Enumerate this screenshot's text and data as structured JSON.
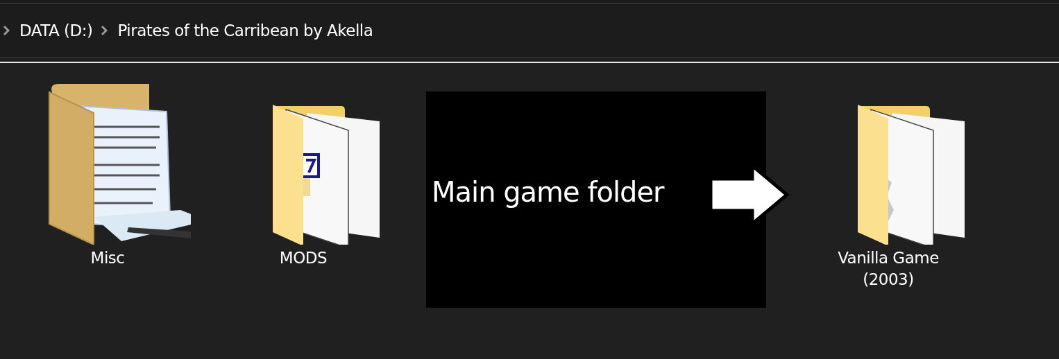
{
  "breadcrumb": [
    {
      "label": "DATA (D:)"
    },
    {
      "label": "Pirates of the Carribean by Akella"
    }
  ],
  "items": [
    {
      "kind": "papers",
      "label": "Misc"
    },
    {
      "kind": "badge",
      "label": "MODS"
    },
    {
      "kind": "annotation",
      "label": "Main game folder"
    },
    {
      "kind": "gear",
      "label": "Vanilla Game (2003)"
    }
  ]
}
